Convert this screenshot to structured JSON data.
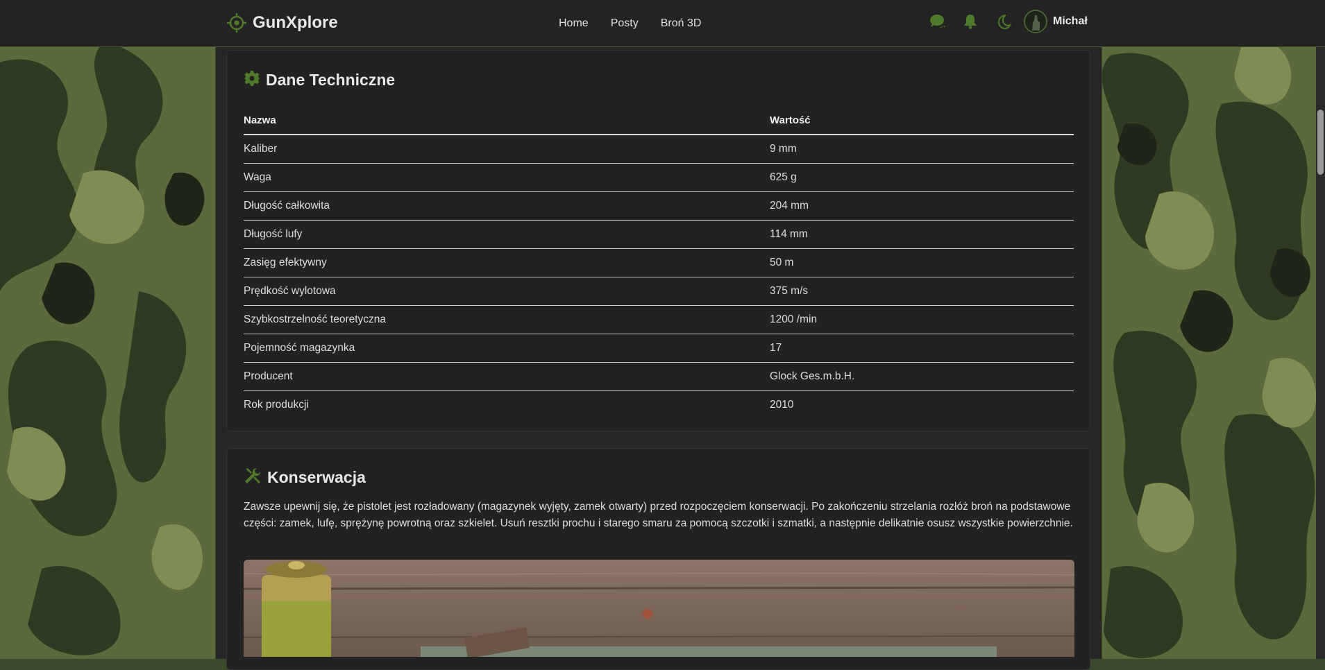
{
  "brand": {
    "name": "GunXplore",
    "accent": "#4f7a2a"
  },
  "nav": {
    "links": [
      "Home",
      "Posty",
      "Broń 3D"
    ]
  },
  "user": {
    "name": "Michał"
  },
  "icons": {
    "brand": "crosshair-icon",
    "chat": "chat-icon",
    "notifications": "bell-icon",
    "theme": "moon-icon"
  },
  "specs": {
    "title": "Dane Techniczne",
    "headers": [
      "Nazwa",
      "Wartość"
    ],
    "rows": [
      [
        "Kaliber",
        "9 mm"
      ],
      [
        "Waga",
        "625 g"
      ],
      [
        "Długość całkowita",
        "204 mm"
      ],
      [
        "Długość lufy",
        "114 mm"
      ],
      [
        "Zasięg efektywny",
        "50 m"
      ],
      [
        "Prędkość wylotowa",
        "375 m/s"
      ],
      [
        "Szybkostrzelność teoretyczna",
        "1200 /min"
      ],
      [
        "Pojemność magazynka",
        "17"
      ],
      [
        "Producent",
        "Glock Ges.m.b.H."
      ],
      [
        "Rok produkcji",
        "2010"
      ]
    ]
  },
  "maintenance": {
    "title": "Konserwacja",
    "text": "Zawsze upewnij się, że pistolet jest rozładowany (magazynek wyjęty, zamek otwarty) przed rozpoczęciem konserwacji. Po zakończeniu strzelania rozłóż broń na podstawowe części: zamek, lufę, sprężynę powrotną oraz szkielet. Usuń resztki prochu i starego smaru za pomocą szczotki i szmatki, a następnie delikatnie osusz wszystkie powierzchnie."
  }
}
